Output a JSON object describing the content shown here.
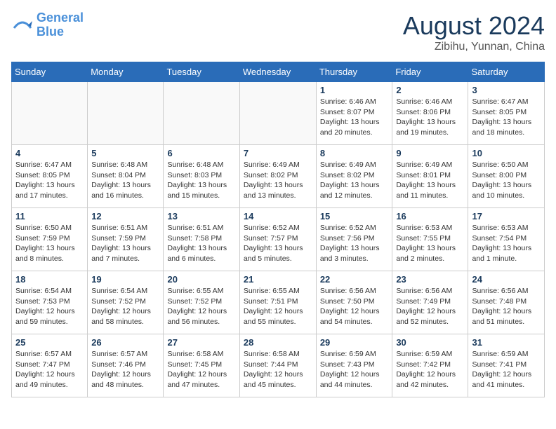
{
  "header": {
    "logo_line1": "General",
    "logo_line2": "Blue",
    "month_year": "August 2024",
    "location": "Zibihu, Yunnan, China"
  },
  "days_of_week": [
    "Sunday",
    "Monday",
    "Tuesday",
    "Wednesday",
    "Thursday",
    "Friday",
    "Saturday"
  ],
  "weeks": [
    [
      {
        "day": "",
        "info": ""
      },
      {
        "day": "",
        "info": ""
      },
      {
        "day": "",
        "info": ""
      },
      {
        "day": "",
        "info": ""
      },
      {
        "day": "1",
        "info": "Sunrise: 6:46 AM\nSunset: 8:07 PM\nDaylight: 13 hours\nand 20 minutes."
      },
      {
        "day": "2",
        "info": "Sunrise: 6:46 AM\nSunset: 8:06 PM\nDaylight: 13 hours\nand 19 minutes."
      },
      {
        "day": "3",
        "info": "Sunrise: 6:47 AM\nSunset: 8:05 PM\nDaylight: 13 hours\nand 18 minutes."
      }
    ],
    [
      {
        "day": "4",
        "info": "Sunrise: 6:47 AM\nSunset: 8:05 PM\nDaylight: 13 hours\nand 17 minutes."
      },
      {
        "day": "5",
        "info": "Sunrise: 6:48 AM\nSunset: 8:04 PM\nDaylight: 13 hours\nand 16 minutes."
      },
      {
        "day": "6",
        "info": "Sunrise: 6:48 AM\nSunset: 8:03 PM\nDaylight: 13 hours\nand 15 minutes."
      },
      {
        "day": "7",
        "info": "Sunrise: 6:49 AM\nSunset: 8:02 PM\nDaylight: 13 hours\nand 13 minutes."
      },
      {
        "day": "8",
        "info": "Sunrise: 6:49 AM\nSunset: 8:02 PM\nDaylight: 13 hours\nand 12 minutes."
      },
      {
        "day": "9",
        "info": "Sunrise: 6:49 AM\nSunset: 8:01 PM\nDaylight: 13 hours\nand 11 minutes."
      },
      {
        "day": "10",
        "info": "Sunrise: 6:50 AM\nSunset: 8:00 PM\nDaylight: 13 hours\nand 10 minutes."
      }
    ],
    [
      {
        "day": "11",
        "info": "Sunrise: 6:50 AM\nSunset: 7:59 PM\nDaylight: 13 hours\nand 8 minutes."
      },
      {
        "day": "12",
        "info": "Sunrise: 6:51 AM\nSunset: 7:59 PM\nDaylight: 13 hours\nand 7 minutes."
      },
      {
        "day": "13",
        "info": "Sunrise: 6:51 AM\nSunset: 7:58 PM\nDaylight: 13 hours\nand 6 minutes."
      },
      {
        "day": "14",
        "info": "Sunrise: 6:52 AM\nSunset: 7:57 PM\nDaylight: 13 hours\nand 5 minutes."
      },
      {
        "day": "15",
        "info": "Sunrise: 6:52 AM\nSunset: 7:56 PM\nDaylight: 13 hours\nand 3 minutes."
      },
      {
        "day": "16",
        "info": "Sunrise: 6:53 AM\nSunset: 7:55 PM\nDaylight: 13 hours\nand 2 minutes."
      },
      {
        "day": "17",
        "info": "Sunrise: 6:53 AM\nSunset: 7:54 PM\nDaylight: 13 hours\nand 1 minute."
      }
    ],
    [
      {
        "day": "18",
        "info": "Sunrise: 6:54 AM\nSunset: 7:53 PM\nDaylight: 12 hours\nand 59 minutes."
      },
      {
        "day": "19",
        "info": "Sunrise: 6:54 AM\nSunset: 7:52 PM\nDaylight: 12 hours\nand 58 minutes."
      },
      {
        "day": "20",
        "info": "Sunrise: 6:55 AM\nSunset: 7:52 PM\nDaylight: 12 hours\nand 56 minutes."
      },
      {
        "day": "21",
        "info": "Sunrise: 6:55 AM\nSunset: 7:51 PM\nDaylight: 12 hours\nand 55 minutes."
      },
      {
        "day": "22",
        "info": "Sunrise: 6:56 AM\nSunset: 7:50 PM\nDaylight: 12 hours\nand 54 minutes."
      },
      {
        "day": "23",
        "info": "Sunrise: 6:56 AM\nSunset: 7:49 PM\nDaylight: 12 hours\nand 52 minutes."
      },
      {
        "day": "24",
        "info": "Sunrise: 6:56 AM\nSunset: 7:48 PM\nDaylight: 12 hours\nand 51 minutes."
      }
    ],
    [
      {
        "day": "25",
        "info": "Sunrise: 6:57 AM\nSunset: 7:47 PM\nDaylight: 12 hours\nand 49 minutes."
      },
      {
        "day": "26",
        "info": "Sunrise: 6:57 AM\nSunset: 7:46 PM\nDaylight: 12 hours\nand 48 minutes."
      },
      {
        "day": "27",
        "info": "Sunrise: 6:58 AM\nSunset: 7:45 PM\nDaylight: 12 hours\nand 47 minutes."
      },
      {
        "day": "28",
        "info": "Sunrise: 6:58 AM\nSunset: 7:44 PM\nDaylight: 12 hours\nand 45 minutes."
      },
      {
        "day": "29",
        "info": "Sunrise: 6:59 AM\nSunset: 7:43 PM\nDaylight: 12 hours\nand 44 minutes."
      },
      {
        "day": "30",
        "info": "Sunrise: 6:59 AM\nSunset: 7:42 PM\nDaylight: 12 hours\nand 42 minutes."
      },
      {
        "day": "31",
        "info": "Sunrise: 6:59 AM\nSunset: 7:41 PM\nDaylight: 12 hours\nand 41 minutes."
      }
    ]
  ]
}
